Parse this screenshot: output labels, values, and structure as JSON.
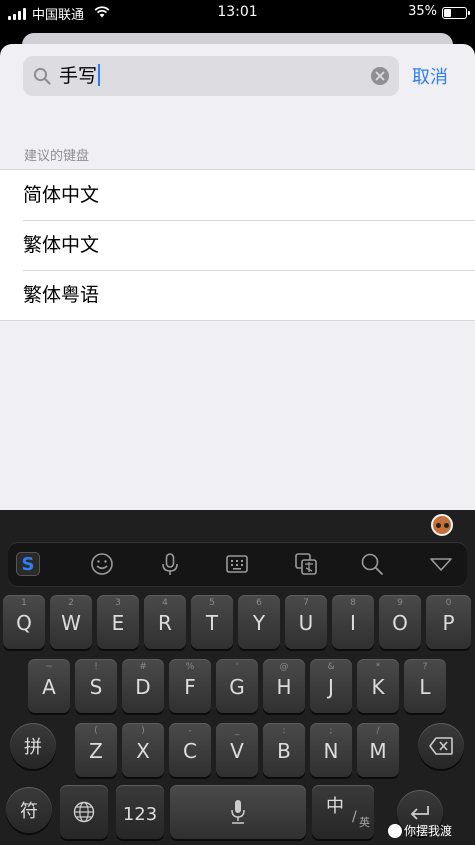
{
  "status_bar": {
    "carrier": "中国联通",
    "time": "13:01",
    "battery_percent": "35%",
    "battery_level": 0.35
  },
  "search": {
    "query": "手写",
    "cancel_label": "取消"
  },
  "suggestions": {
    "header": "建议的键盘",
    "items": [
      {
        "label": "简体中文"
      },
      {
        "label": "繁体中文"
      },
      {
        "label": "繁体粤语"
      }
    ]
  },
  "keyboard": {
    "row1": [
      {
        "label": "Q",
        "sub": "1"
      },
      {
        "label": "W",
        "sub": "2"
      },
      {
        "label": "E",
        "sub": "3"
      },
      {
        "label": "R",
        "sub": "4"
      },
      {
        "label": "T",
        "sub": "5"
      },
      {
        "label": "Y",
        "sub": "6"
      },
      {
        "label": "U",
        "sub": "7"
      },
      {
        "label": "I",
        "sub": "8"
      },
      {
        "label": "O",
        "sub": "9"
      },
      {
        "label": "P",
        "sub": "0"
      }
    ],
    "row2": [
      {
        "label": "A",
        "sub": "~"
      },
      {
        "label": "S",
        "sub": "!"
      },
      {
        "label": "D",
        "sub": "#"
      },
      {
        "label": "F",
        "sub": "%"
      },
      {
        "label": "G",
        "sub": "'"
      },
      {
        "label": "H",
        "sub": "@"
      },
      {
        "label": "J",
        "sub": "&"
      },
      {
        "label": "K",
        "sub": "*"
      },
      {
        "label": "L",
        "sub": "?"
      }
    ],
    "row3": [
      {
        "label": "Z",
        "sub": "("
      },
      {
        "label": "X",
        "sub": ")"
      },
      {
        "label": "C",
        "sub": "-"
      },
      {
        "label": "V",
        "sub": "_"
      },
      {
        "label": "B",
        "sub": ":"
      },
      {
        "label": "N",
        "sub": ";"
      },
      {
        "label": "M",
        "sub": "/"
      }
    ],
    "pinyin_label": "拼",
    "symbol_label": "符",
    "numbers_label": "123",
    "lang_main": "中",
    "lang_slash": "/",
    "lang_alt": "英"
  },
  "watermark": {
    "text": "你摆我渡"
  },
  "colors": {
    "accent": "#2f7df6",
    "keyboard_bg": "#1f1f1f",
    "key_bg": "#3c3c3c"
  }
}
